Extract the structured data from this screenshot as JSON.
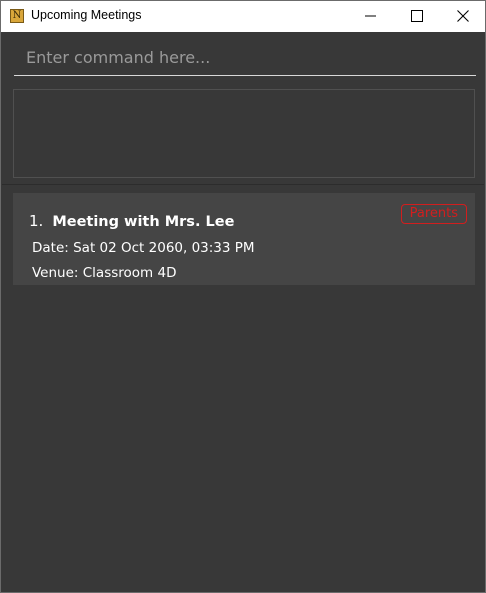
{
  "window": {
    "title": "Upcoming Meetings",
    "icon": "app-n-icon",
    "icon_letter": "N"
  },
  "command": {
    "placeholder": "Enter command here...",
    "value": ""
  },
  "result_display": {
    "text": ""
  },
  "meetings": [
    {
      "index": "1.",
      "title": "Meeting with Mrs. Lee",
      "tag": "Parents",
      "date": "Date: Sat 02 Oct 2060, 03:33 PM",
      "venue": "Venue: Classroom 4D"
    }
  ],
  "colors": {
    "background": "#383838",
    "card": "#454545",
    "tag": "#d21e1e",
    "text": "#ffffff"
  }
}
